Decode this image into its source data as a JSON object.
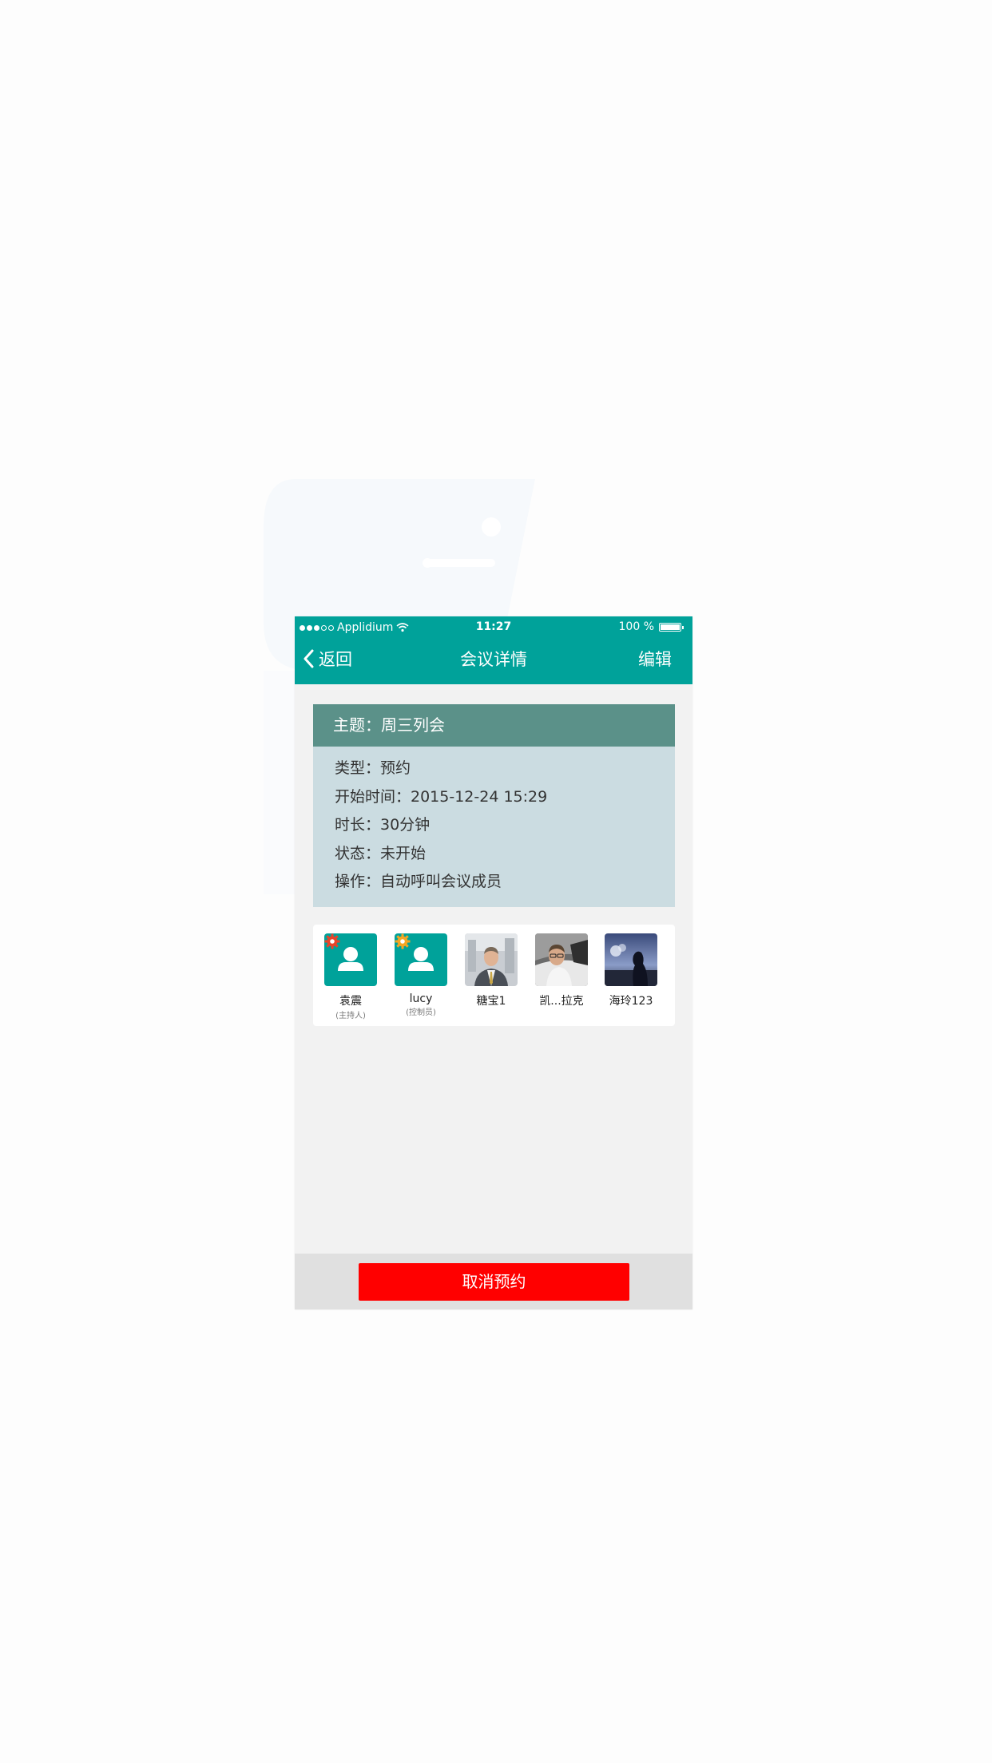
{
  "status_bar": {
    "carrier": "Applidium",
    "time": "11:27",
    "battery": "100 %"
  },
  "nav": {
    "back_label": "返回",
    "title": "会议详情",
    "edit_label": "编辑"
  },
  "meeting": {
    "subject": "主题：周三列会",
    "details": [
      "类型：预约",
      "开始时间：2015-12-24 15:29",
      "时长：30分钟",
      "状态：未开始",
      "操作：自动呼叫会议成员"
    ]
  },
  "members": [
    {
      "name": "袁震",
      "role": "(主持人)",
      "avatar": "default-user-icon",
      "badge_color": "#e8442a"
    },
    {
      "name": "lucy",
      "role": "(控制员)",
      "avatar": "default-user-icon",
      "badge_color": "#f5a623"
    },
    {
      "name": "糖宝1",
      "role": "",
      "avatar": "photo-man-suit"
    },
    {
      "name": "凯...拉克",
      "role": "",
      "avatar": "photo-man-car"
    },
    {
      "name": "海玲123",
      "role": "",
      "avatar": "photo-woman-silhouette"
    }
  ],
  "actions": {
    "cancel_label": "取消预约"
  },
  "colors": {
    "primary": "#00a29a",
    "card_header": "#5b9189",
    "card_body": "#cbdce1",
    "danger": "#ff0000"
  }
}
